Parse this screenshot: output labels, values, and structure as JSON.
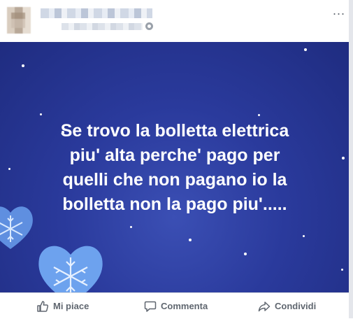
{
  "post": {
    "text_lines": [
      "Se trovo la bolletta elettrica",
      "piu' alta perche' pago per",
      "quelli che non pagano io la",
      "bolletta non la pago piu'....."
    ],
    "more_menu": "..."
  },
  "actions": {
    "like_label": "Mi piace",
    "comment_label": "Commenta",
    "share_label": "Condividi"
  },
  "colors": {
    "background_top": "#2a3a9c",
    "background_bottom": "#1f2c80",
    "action_text": "#606770"
  },
  "icons": [
    "audience-globe-icon",
    "more-options-icon",
    "like-thumb-icon",
    "comment-bubble-icon",
    "share-arrow-icon",
    "snowflake-heart-icon"
  ]
}
